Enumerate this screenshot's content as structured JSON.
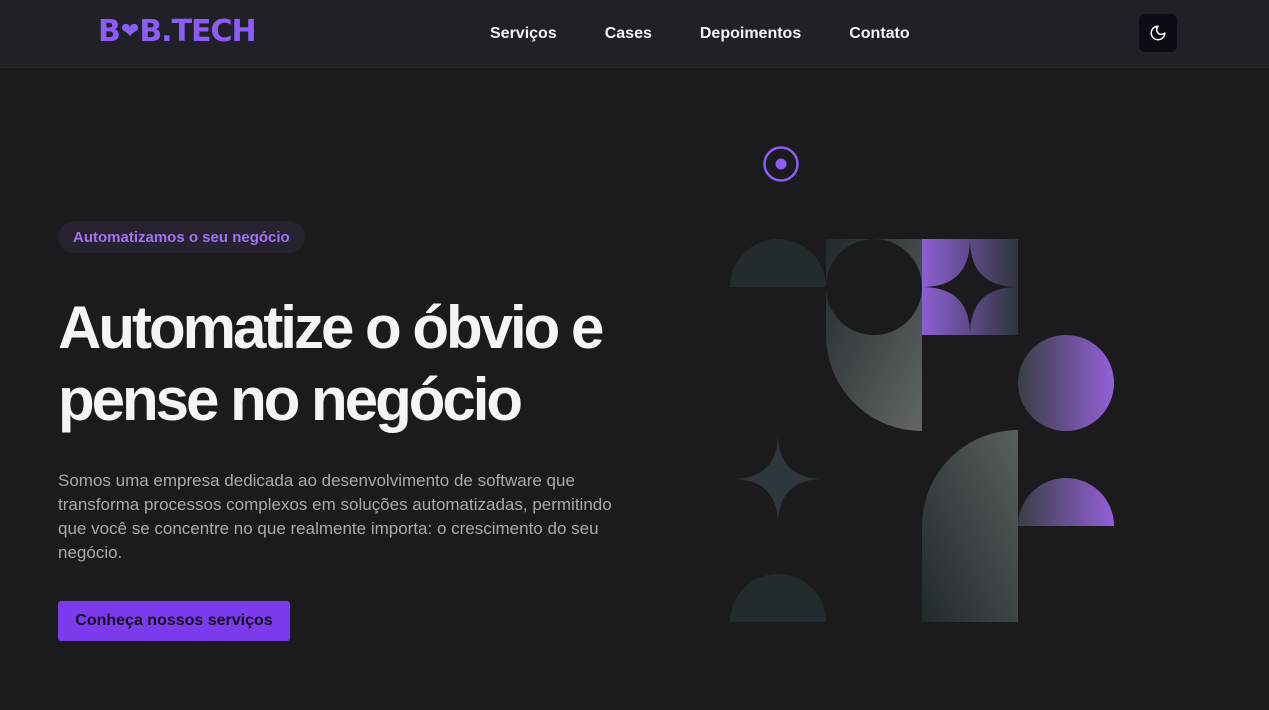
{
  "header": {
    "logo_text": "B2B.TECH",
    "nav": [
      {
        "label": "Serviços"
      },
      {
        "label": "Cases"
      },
      {
        "label": "Depoimentos"
      },
      {
        "label": "Contato"
      }
    ],
    "theme_toggle_icon": "moon-icon"
  },
  "hero": {
    "badge": "Automatizamos o seu negócio",
    "headline_line1": "Automatize o óbvio e",
    "headline_line2": "pense no negócio",
    "description": "Somos uma empresa dedicada ao desenvolvimento de software que transforma processos complexos em soluções automatizadas, permitindo que você se concentre no que realmente importa: o crescimento do seu negócio.",
    "cta_label": "Conheça nossos serviços"
  },
  "colors": {
    "accent": "#7c3aed",
    "background": "#1b1b1e",
    "header": "#1f2126"
  }
}
